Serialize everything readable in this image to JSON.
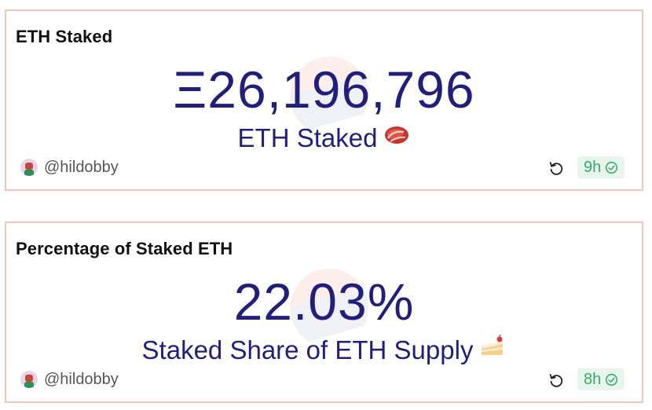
{
  "cards": [
    {
      "title": "ETH Staked",
      "value": "Ξ26,196,796",
      "subtitle": "ETH Staked",
      "emoji": "meat-icon",
      "author": "@hildobby",
      "age": "9h"
    },
    {
      "title": "Percentage of Staked ETH",
      "value": "22.03%",
      "subtitle": "Staked Share of ETH Supply",
      "emoji": "cake-icon",
      "author": "@hildobby",
      "age": "8h"
    }
  ],
  "colors": {
    "accent": "#221f7a",
    "border": "#f2c6bd",
    "badge_bg": "#e7f6ec",
    "badge_fg": "#3aa864"
  }
}
